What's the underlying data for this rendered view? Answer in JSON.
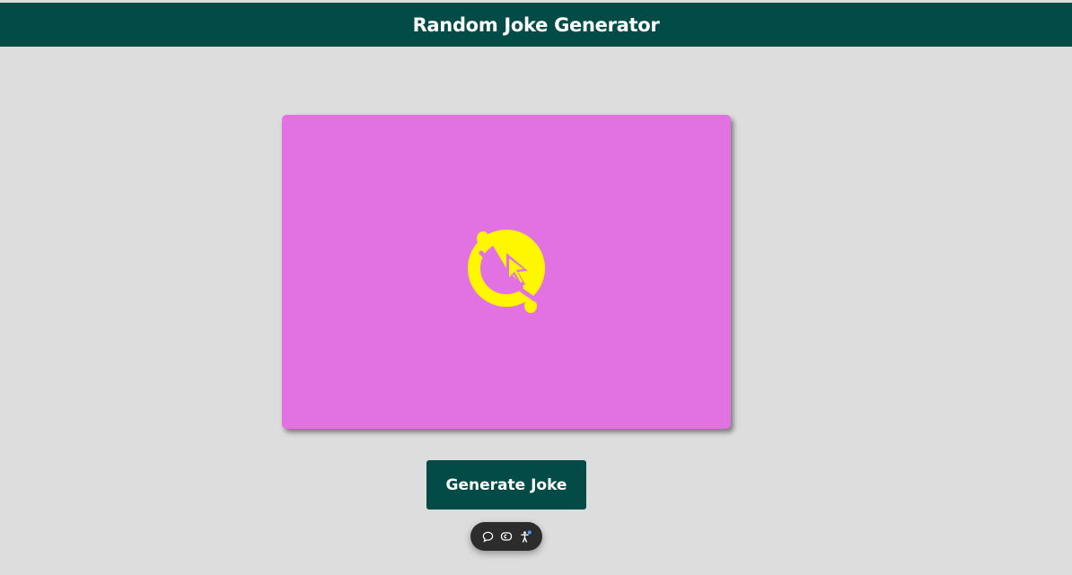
{
  "header": {
    "title": "Random Joke Generator"
  },
  "joke_card": {
    "icon": "laughing-emoji-icon"
  },
  "actions": {
    "generate_label": "Generate Joke"
  },
  "toolbar": {
    "icons": [
      "comment-icon",
      "caption-icon",
      "accessibility-icon"
    ]
  },
  "colors": {
    "header_bg": "#024b47",
    "page_bg": "#dddddd",
    "card_bg": "#e272e2",
    "emoji": "#fff700",
    "button_bg": "#024b47",
    "toolbar_bg": "#2c2c2c",
    "toolbar_badge": "#4a9cff"
  }
}
